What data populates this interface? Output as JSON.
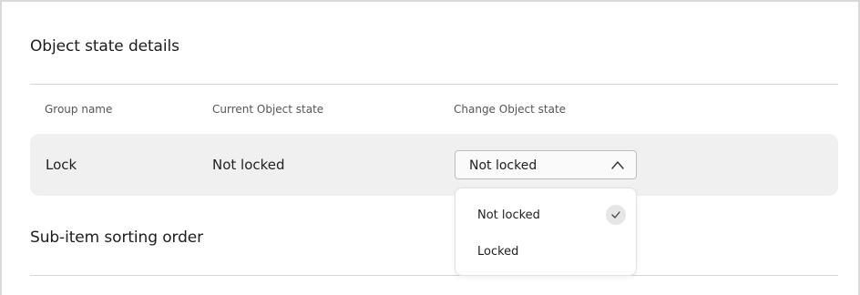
{
  "object_state": {
    "title": "Object state details",
    "columns": {
      "group_name": "Group name",
      "current_state": "Current Object state",
      "change_state": "Change Object state"
    },
    "rows": [
      {
        "group_name": "Lock",
        "current_state": "Not locked",
        "selected_value": "Not locked"
      }
    ],
    "dropdown": {
      "open": true,
      "options": [
        {
          "label": "Not locked",
          "selected": true
        },
        {
          "label": "Locked",
          "selected": false
        }
      ],
      "toggle_icon": "chevron-up-icon",
      "check_icon": "checkmark-icon"
    }
  },
  "sub_item_sorting": {
    "title": "Sub-item sorting order"
  },
  "colors": {
    "row_background": "#f0f0f0",
    "divider": "#d6d6d6",
    "check_badge": "#e6e6e6"
  }
}
